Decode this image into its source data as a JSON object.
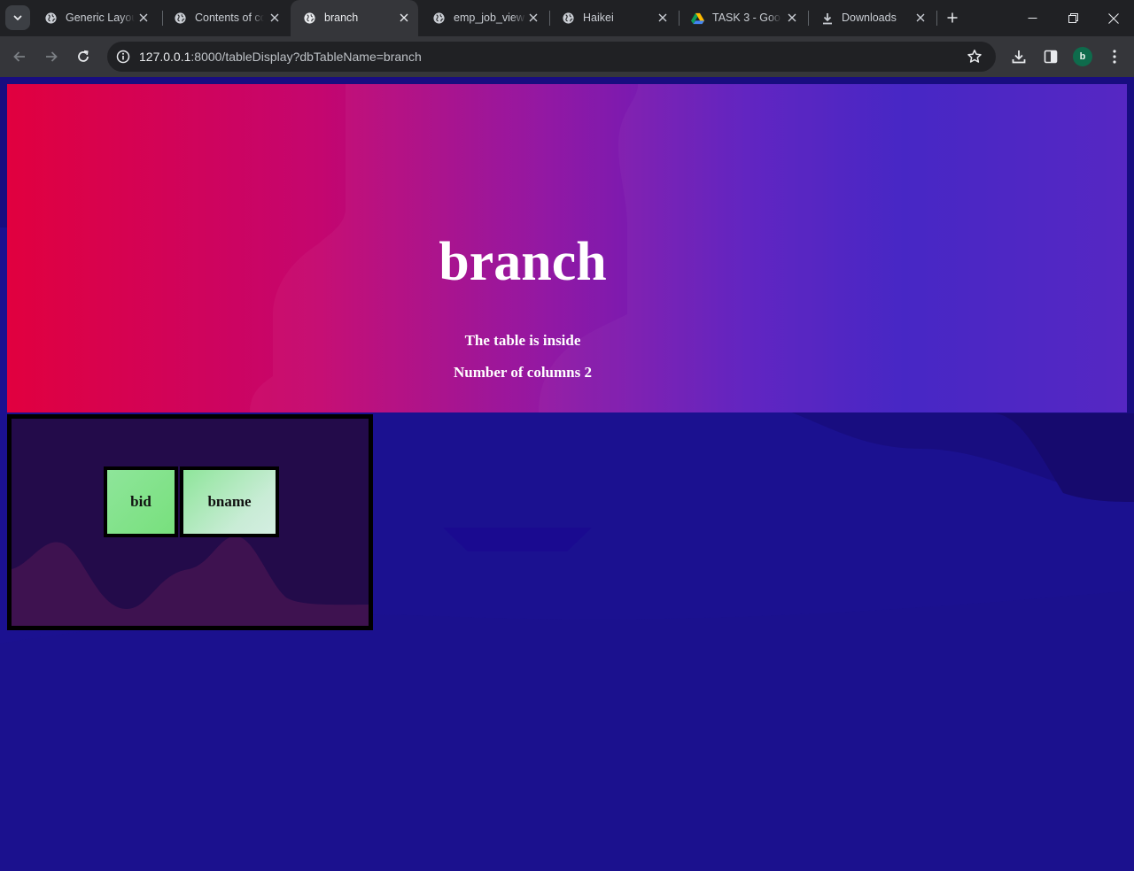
{
  "browser": {
    "tabs": [
      {
        "title": "Generic Layout",
        "icon": "globe-icon",
        "active": false
      },
      {
        "title": "Contents of co",
        "icon": "globe-icon",
        "active": false
      },
      {
        "title": "branch",
        "icon": "globe-icon",
        "active": true
      },
      {
        "title": "emp_job_view",
        "icon": "globe-icon",
        "active": false
      },
      {
        "title": "Haikei",
        "icon": "globe-icon",
        "active": false
      },
      {
        "title": "TASK 3 - Goog",
        "icon": "google-drive-icon",
        "active": false
      },
      {
        "title": "Downloads",
        "icon": "download-icon",
        "active": false
      }
    ],
    "url_host": "127.0.0.1",
    "url_rest": ":8000/tableDisplay?dbTableName=branch",
    "profile_initial": "b",
    "colors": {
      "tabstrip": "#202124",
      "toolbar": "#35363a",
      "avatar": "#0e6b4c"
    }
  },
  "page": {
    "title": "branch",
    "subtitle": "The table is inside",
    "columns_text": "Number of columns 2",
    "table_columns": [
      "bid",
      "bname"
    ],
    "colors": {
      "gradient_start": "#e1003f",
      "gradient_end": "#3b17c2",
      "background": "#1b0f88",
      "card": "#230b4a",
      "cell_green": "#78e07d"
    }
  }
}
